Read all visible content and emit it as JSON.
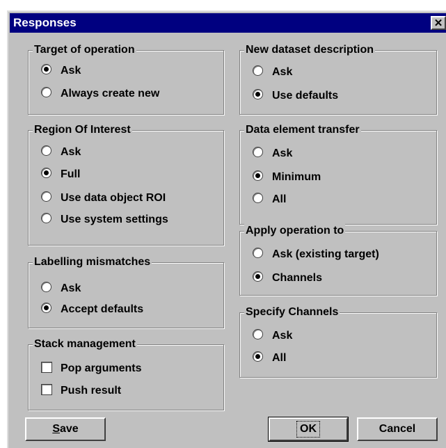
{
  "window": {
    "title": "Responses",
    "close_label": "✕"
  },
  "groups": {
    "target": {
      "title": "Target of operation",
      "options": [
        "Ask",
        "Always create new"
      ],
      "selected": 0
    },
    "roi": {
      "title": "Region Of Interest",
      "options": [
        "Ask",
        "Full",
        "Use data object ROI",
        "Use system settings"
      ],
      "selected": 1
    },
    "labelling": {
      "title": "Labelling mismatches",
      "options": [
        "Ask",
        "Accept defaults"
      ],
      "selected": 1
    },
    "stack": {
      "title": "Stack management",
      "checks": [
        {
          "label": "Pop arguments",
          "checked": false
        },
        {
          "label": "Push result",
          "checked": false
        }
      ]
    },
    "newdataset": {
      "title": "New dataset description",
      "options": [
        "Ask",
        "Use defaults"
      ],
      "selected": 1
    },
    "transfer": {
      "title": "Data element transfer",
      "options": [
        "Ask",
        "Minimum",
        "All"
      ],
      "selected": 1
    },
    "apply": {
      "title": "Apply operation to",
      "options": [
        "Ask (existing target)",
        "Channels"
      ],
      "selected": 1
    },
    "channels": {
      "title": "Specify Channels",
      "options": [
        "Ask",
        "All"
      ],
      "selected": 1
    }
  },
  "buttons": {
    "save": {
      "mnemonic": "S",
      "rest": "ave"
    },
    "ok": {
      "label": "OK"
    },
    "cancel": {
      "label": "Cancel"
    }
  }
}
